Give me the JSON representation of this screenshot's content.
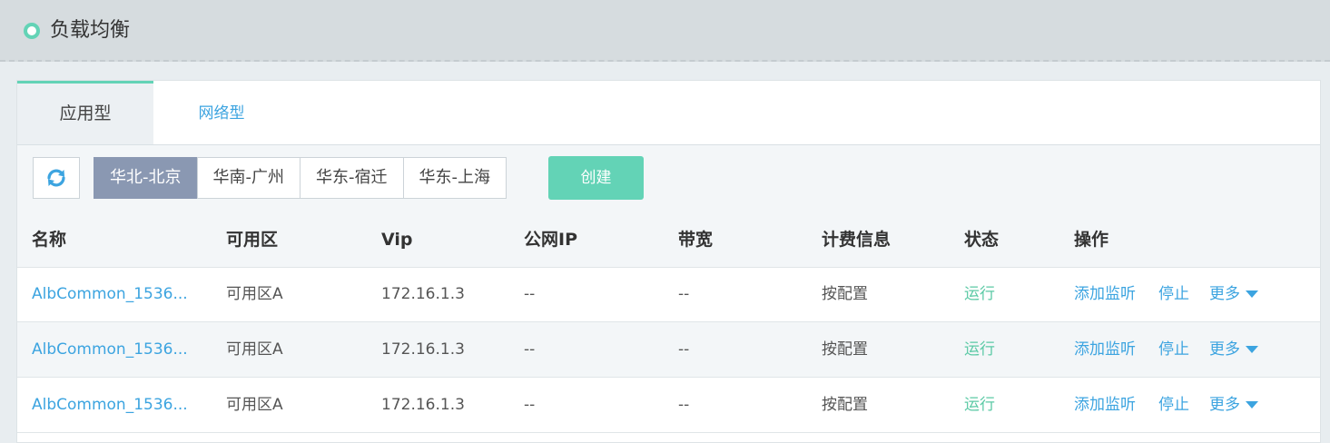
{
  "header": {
    "title": "负载均衡"
  },
  "tabs": [
    {
      "label": "应用型",
      "active": true
    },
    {
      "label": "网络型",
      "active": false
    }
  ],
  "toolbar": {
    "refresh_icon": "refresh-icon",
    "regions": [
      "华北-北京",
      "华南-广州",
      "华东-宿迁",
      "华东-上海"
    ],
    "selected_region": "华北-北京",
    "create_label": "创建"
  },
  "table": {
    "columns": [
      "名称",
      "可用区",
      "Vip",
      "公网IP",
      "带宽",
      "计费信息",
      "状态",
      "操作"
    ],
    "rows": [
      {
        "name": "AlbCommon_1536...",
        "zone": "可用区A",
        "vip": "172.16.1.3",
        "public_ip": "--",
        "bandwidth": "--",
        "billing": "按配置",
        "status": "运行",
        "action_listen": "添加监听",
        "action_stop": "停止",
        "action_more": "更多"
      },
      {
        "name": "AlbCommon_1536...",
        "zone": "可用区A",
        "vip": "172.16.1.3",
        "public_ip": "--",
        "bandwidth": "--",
        "billing": "按配置",
        "status": "运行",
        "action_listen": "添加监听",
        "action_stop": "停止",
        "action_more": "更多"
      },
      {
        "name": "AlbCommon_1536...",
        "zone": "可用区A",
        "vip": "172.16.1.3",
        "public_ip": "--",
        "bandwidth": "--",
        "billing": "按配置",
        "status": "运行",
        "action_listen": "添加监听",
        "action_stop": "停止",
        "action_more": "更多"
      }
    ]
  },
  "colors": {
    "accent": "#63d3b6",
    "link": "#3ca4e0",
    "region_active": "#8a98b2"
  }
}
